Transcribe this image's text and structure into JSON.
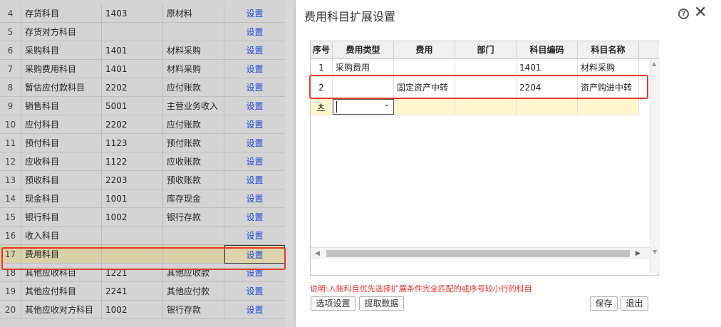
{
  "left_table": {
    "action_label": "设置",
    "rows": [
      {
        "num": "4",
        "name": "存货科目",
        "code": "1403",
        "subject": "原材料"
      },
      {
        "num": "5",
        "name": "存货对方科目",
        "code": "",
        "subject": ""
      },
      {
        "num": "6",
        "name": "采购科目",
        "code": "1401",
        "subject": "材料采购"
      },
      {
        "num": "7",
        "name": "采购费用科目",
        "code": "1401",
        "subject": "材料采购"
      },
      {
        "num": "8",
        "name": "暂估应付款科目",
        "code": "2202",
        "subject": "应付账款"
      },
      {
        "num": "9",
        "name": "销售科目",
        "code": "5001",
        "subject": "主营业务收入"
      },
      {
        "num": "10",
        "name": "应付科目",
        "code": "2202",
        "subject": "应付账款"
      },
      {
        "num": "11",
        "name": "预付科目",
        "code": "1123",
        "subject": "预付账款"
      },
      {
        "num": "12",
        "name": "应收科目",
        "code": "1122",
        "subject": "应收账款"
      },
      {
        "num": "13",
        "name": "预收科目",
        "code": "2203",
        "subject": "预收账款"
      },
      {
        "num": "14",
        "name": "现金科目",
        "code": "1001",
        "subject": "库存现金"
      },
      {
        "num": "15",
        "name": "银行科目",
        "code": "1002",
        "subject": "银行存款"
      },
      {
        "num": "16",
        "name": "收入科目",
        "code": "",
        "subject": ""
      },
      {
        "num": "17",
        "name": "费用科目",
        "code": "",
        "subject": ""
      },
      {
        "num": "18",
        "name": "其他应收科目",
        "code": "1221",
        "subject": "其他应收款"
      },
      {
        "num": "19",
        "name": "其他应付科目",
        "code": "2241",
        "subject": "其他应付款"
      },
      {
        "num": "20",
        "name": "其他应收对方科目",
        "code": "1002",
        "subject": "银行存款"
      }
    ]
  },
  "dialog": {
    "title": "费用科目扩展设置",
    "help_icon": "?",
    "close_icon": "✕",
    "columns": [
      "序号",
      "费用类型",
      "费用",
      "部门",
      "科目编码",
      "科目名称"
    ],
    "rows": [
      {
        "num": "1",
        "type": "采购费用",
        "fee": "",
        "dept": "",
        "code": "1401",
        "name": "材料采购"
      },
      {
        "num": "2",
        "type": "",
        "fee": "固定资产中转",
        "dept": "",
        "code": "2204",
        "name": "资产购进中转"
      }
    ],
    "new_row_marker": "ㅊ",
    "note": "说明:入账科目优先选择扩展条件完全匹配的或序号较小行的科目",
    "buttons": {
      "options": "选项设置",
      "fetch": "提取数据",
      "save": "保存",
      "exit": "退出"
    }
  }
}
